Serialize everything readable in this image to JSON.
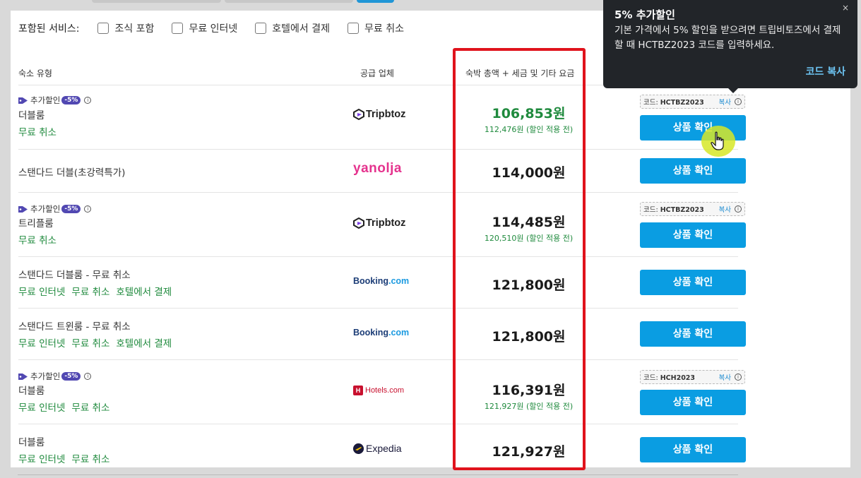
{
  "filters": {
    "label": "포함된 서비스:",
    "options": [
      "조식 포함",
      "무료 인터넷",
      "호텔에서 결제",
      "무료 취소"
    ]
  },
  "table_header": {
    "room_type": "숙소 유형",
    "supplier": "공급 업체",
    "price": "숙박 총액 + 세금 및 기타 요금"
  },
  "discount_tag": {
    "label": "추가할인",
    "badge": "-5%",
    "info": "i"
  },
  "rows": [
    {
      "room": "더블룸",
      "features": [
        "무료 취소"
      ],
      "supplier": "Tripbtoz",
      "price": "106,853원",
      "original": "112,476원 (할인 적용 전)",
      "code_label": "코드:",
      "code": "HCTBZ2023",
      "copy": "복사",
      "button": "상품 확인"
    },
    {
      "room": "스탠다드 더블(초강력특가)",
      "features": [],
      "supplier": "yanolja",
      "price": "114,000원",
      "button": "상품 확인"
    },
    {
      "room": "트리플룸",
      "features": [
        "무료 취소"
      ],
      "supplier": "Tripbtoz",
      "price": "114,485원",
      "original": "120,510원 (할인 적용 전)",
      "code_label": "코드:",
      "code": "HCTBZ2023",
      "copy": "복사",
      "button": "상품 확인"
    },
    {
      "room": "스탠다드 더블룸 - 무료 취소",
      "features": [
        "무료 인터넷",
        "무료 취소",
        "호텔에서 결제"
      ],
      "supplier": "Booking",
      "supplier_suffix": ".com",
      "price": "121,800원",
      "button": "상품 확인"
    },
    {
      "room": "스탠다드 트윈룸 - 무료 취소",
      "features": [
        "무료 인터넷",
        "무료 취소",
        "호텔에서 결제"
      ],
      "supplier": "Booking",
      "supplier_suffix": ".com",
      "price": "121,800원",
      "button": "상품 확인"
    },
    {
      "room": "더블룸",
      "features": [
        "무료 인터넷",
        "무료 취소"
      ],
      "supplier": "Hotels.com",
      "price": "116,391원",
      "original": "121,927원 (할인 적용 전)",
      "code_label": "코드:",
      "code": "HCH2023",
      "copy": "복사",
      "button": "상품 확인"
    },
    {
      "room": "더블룸",
      "features": [
        "무료 인터넷",
        "무료 취소"
      ],
      "supplier": "Expedia",
      "price": "121,927원",
      "button": "상품 확인"
    }
  ],
  "tooltip": {
    "title": "5% 추가할인",
    "body": "기본 가격에서 5% 할인을 받으려면 트립비토즈에서 결제할 때 HCTBZ2023 코드를 입력하세요.",
    "action": "코드 복사",
    "close": "×"
  },
  "colors": {
    "accent": "#0a9de2",
    "highlight": "#e0131c",
    "feature_green": "#1f8a3d",
    "badge": "#5148b2"
  }
}
